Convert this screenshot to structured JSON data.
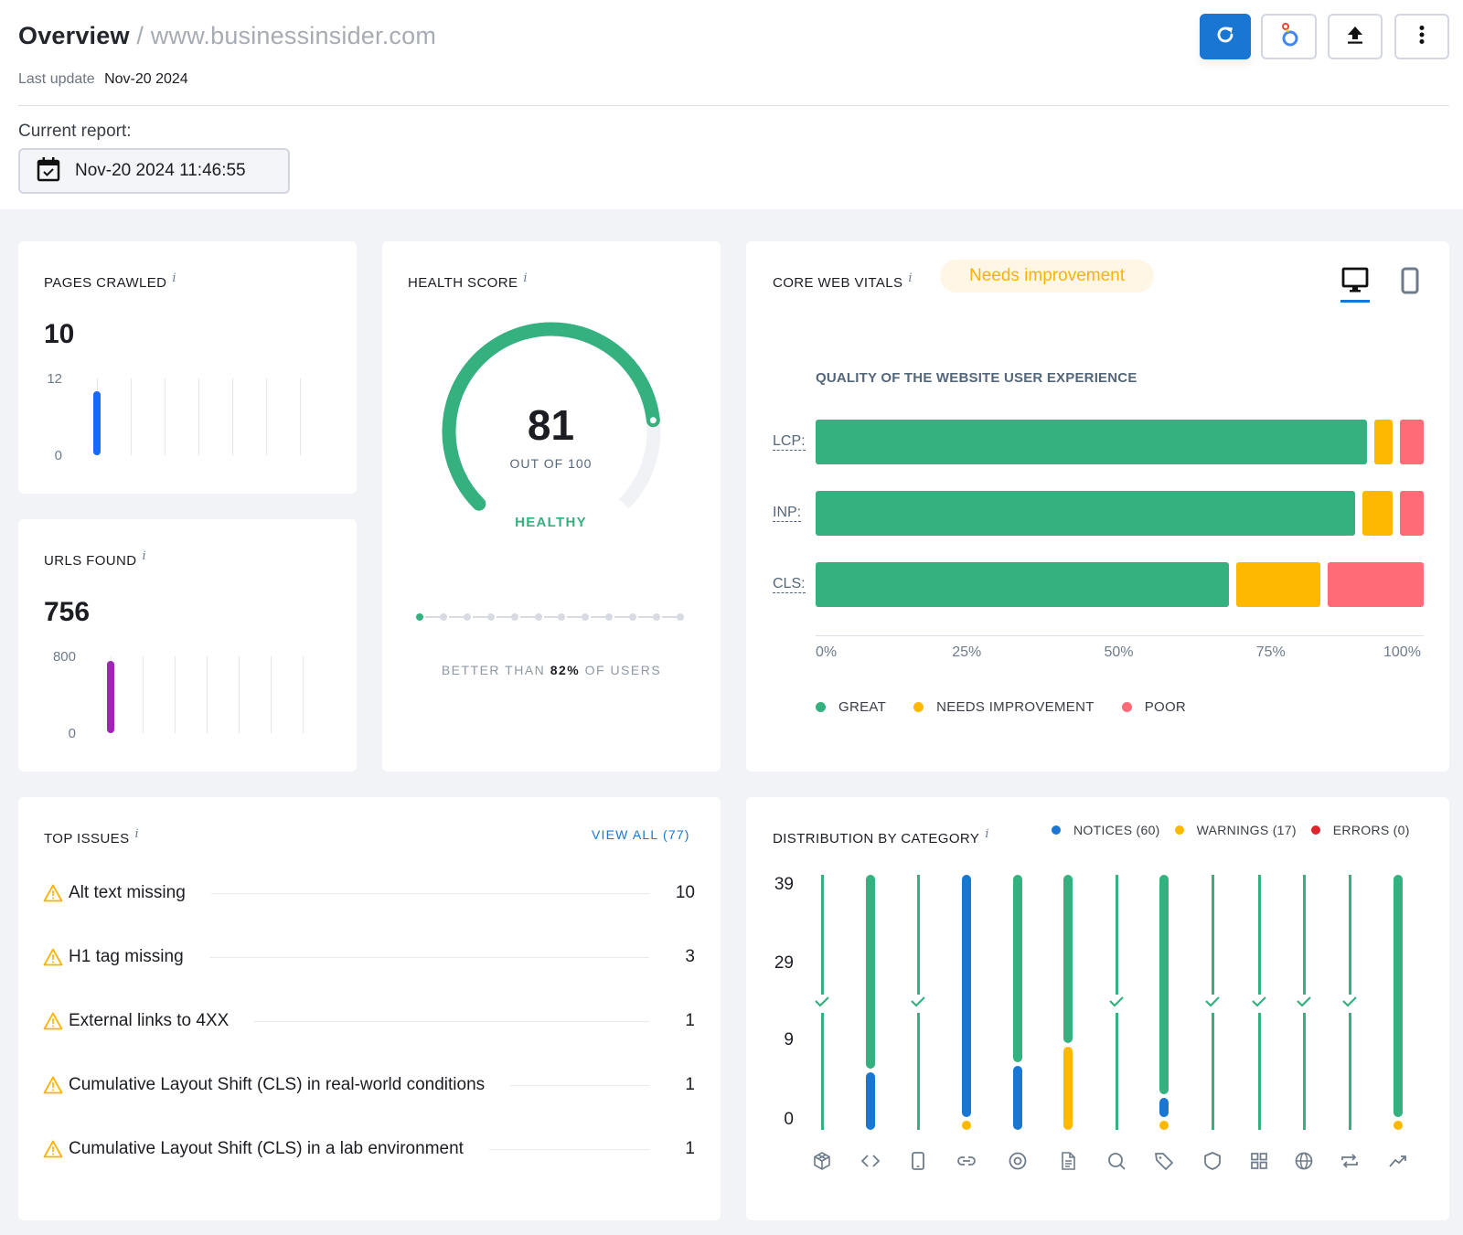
{
  "header": {
    "title": "Overview",
    "separator": "/",
    "domain": "www.businessinsider.com",
    "last_update_label": "Last update",
    "last_update_value": "Nov-20 2024",
    "current_report_label": "Current report:",
    "current_report_value": "Nov-20 2024 11:46:55",
    "buttons": [
      {
        "name": "refresh-button",
        "icon": "refresh-icon"
      },
      {
        "name": "looker-studio-button",
        "icon": "looker-studio-icon"
      },
      {
        "name": "export-button",
        "icon": "upload-icon"
      },
      {
        "name": "more-options-button",
        "icon": "more-vertical-icon"
      }
    ]
  },
  "pages_crawled": {
    "title": "PAGES CRAWLED",
    "info": "i",
    "value": "10",
    "y_max": "12",
    "y_min": "0",
    "spark_value": 10,
    "spark_max": 12,
    "color": "#1a66ff"
  },
  "urls_found": {
    "title": "URLS FOUND",
    "info": "i",
    "value": "756",
    "y_max": "800",
    "y_min": "0",
    "spark_value": 756,
    "spark_max": 800,
    "color": "#9c27b0"
  },
  "health_score": {
    "title": "HEALTH SCORE",
    "info": "i",
    "score": "81",
    "score_value": 81,
    "out_of": "OUT OF 100",
    "status": "HEALTHY",
    "better_than_prefix": "BETTER THAN",
    "better_than_value": "82%",
    "better_than_suffix": "OF USERS",
    "progress_steps": 12,
    "progress_active": 1,
    "color": "#35b07f"
  },
  "core_web_vitals": {
    "title": "CORE WEB VITALS",
    "info": "i",
    "status_badge": "Needs improvement",
    "device_tabs": [
      {
        "name": "desktop",
        "icon": "desktop-icon",
        "active": true
      },
      {
        "name": "mobile",
        "icon": "mobile-icon",
        "active": false
      }
    ],
    "subtitle": "QUALITY OF THE WEBSITE USER EXPERIENCE",
    "legend": [
      {
        "label": "GREAT",
        "color": "#35b07f"
      },
      {
        "label": "NEEDS IMPROVEMENT",
        "color": "#ffb800"
      },
      {
        "label": "POOR",
        "color": "#ff6b76"
      }
    ],
    "ticks": [
      "0%",
      "25%",
      "50%",
      "75%",
      "100%"
    ]
  },
  "top_issues": {
    "title": "TOP ISSUES",
    "info": "i",
    "view_all": "VIEW ALL (77)",
    "items": [
      {
        "name": "Alt text missing",
        "count": "10"
      },
      {
        "name": "H1 tag missing",
        "count": "3"
      },
      {
        "name": "External links to 4XX",
        "count": "1"
      },
      {
        "name": "Cumulative Layout Shift (CLS) in real-world conditions",
        "count": "1"
      },
      {
        "name": "Cumulative Layout Shift (CLS) in a lab environment",
        "count": "1"
      }
    ]
  },
  "distribution": {
    "title": "DISTRIBUTION BY CATEGORY",
    "info": "i",
    "legend": [
      {
        "label": "NOTICES (60)",
        "color": "#1976d2"
      },
      {
        "label": "WARNINGS (17)",
        "color": "#ffb800"
      },
      {
        "label": "ERRORS (0)",
        "color": "#e0232a"
      }
    ],
    "y_ticks": [
      "39",
      "29",
      "9",
      "0"
    ],
    "categories": [
      {
        "icon": "crawlability-icon",
        "healthy": true
      },
      {
        "icon": "code-icon",
        "healthy": false
      },
      {
        "icon": "mobile-icon",
        "healthy": true
      },
      {
        "icon": "link-icon",
        "healthy": false
      },
      {
        "icon": "target-icon",
        "healthy": false
      },
      {
        "icon": "document-icon",
        "healthy": false
      },
      {
        "icon": "search-icon",
        "healthy": true
      },
      {
        "icon": "tag-icon",
        "healthy": false
      },
      {
        "icon": "shield-icon",
        "healthy": true
      },
      {
        "icon": "grid-icon",
        "healthy": true
      },
      {
        "icon": "globe-icon",
        "healthy": true
      },
      {
        "icon": "redirect-icon",
        "healthy": true
      },
      {
        "icon": "trend-icon",
        "healthy": false
      }
    ]
  },
  "chart_data": [
    {
      "type": "bar",
      "title": "QUALITY OF THE WEBSITE USER EXPERIENCE",
      "orientation": "horizontal-stacked",
      "categories": [
        "LCP:",
        "INP:",
        "CLS:"
      ],
      "series": [
        {
          "name": "GREAT",
          "values": [
            92,
            90,
            69
          ]
        },
        {
          "name": "NEEDS IMPROVEMENT",
          "values": [
            3,
            5,
            14
          ]
        },
        {
          "name": "POOR",
          "values": [
            4,
            4,
            16
          ]
        }
      ],
      "xlabel": "",
      "ylabel": "",
      "xlim": [
        0,
        100
      ],
      "x_ticks": [
        "0%",
        "25%",
        "50%",
        "75%",
        "100%"
      ],
      "legend_position": "bottom-left"
    },
    {
      "type": "bar",
      "title": "DISTRIBUTION BY CATEGORY",
      "orientation": "vertical-stacked",
      "categories": [
        "Crawlability",
        "Markup",
        "Mobile",
        "Links",
        "Core Web Vitals",
        "Content",
        "Indexability",
        "Meta tags",
        "Security",
        "Structured data",
        "International SEO",
        "Redirects",
        "Performance"
      ],
      "series": [
        {
          "name": "NOTICES",
          "values": [
            0,
            9,
            0,
            38,
            10,
            0,
            0,
            3,
            0,
            0,
            0,
            0,
            0
          ]
        },
        {
          "name": "WARNINGS",
          "values": [
            0,
            0,
            0,
            1,
            0,
            13,
            0,
            1,
            0,
            0,
            0,
            0,
            1
          ]
        }
      ],
      "y_ticks": [
        "0",
        "9",
        "29",
        "39"
      ],
      "legend_position": "top-right"
    }
  ]
}
